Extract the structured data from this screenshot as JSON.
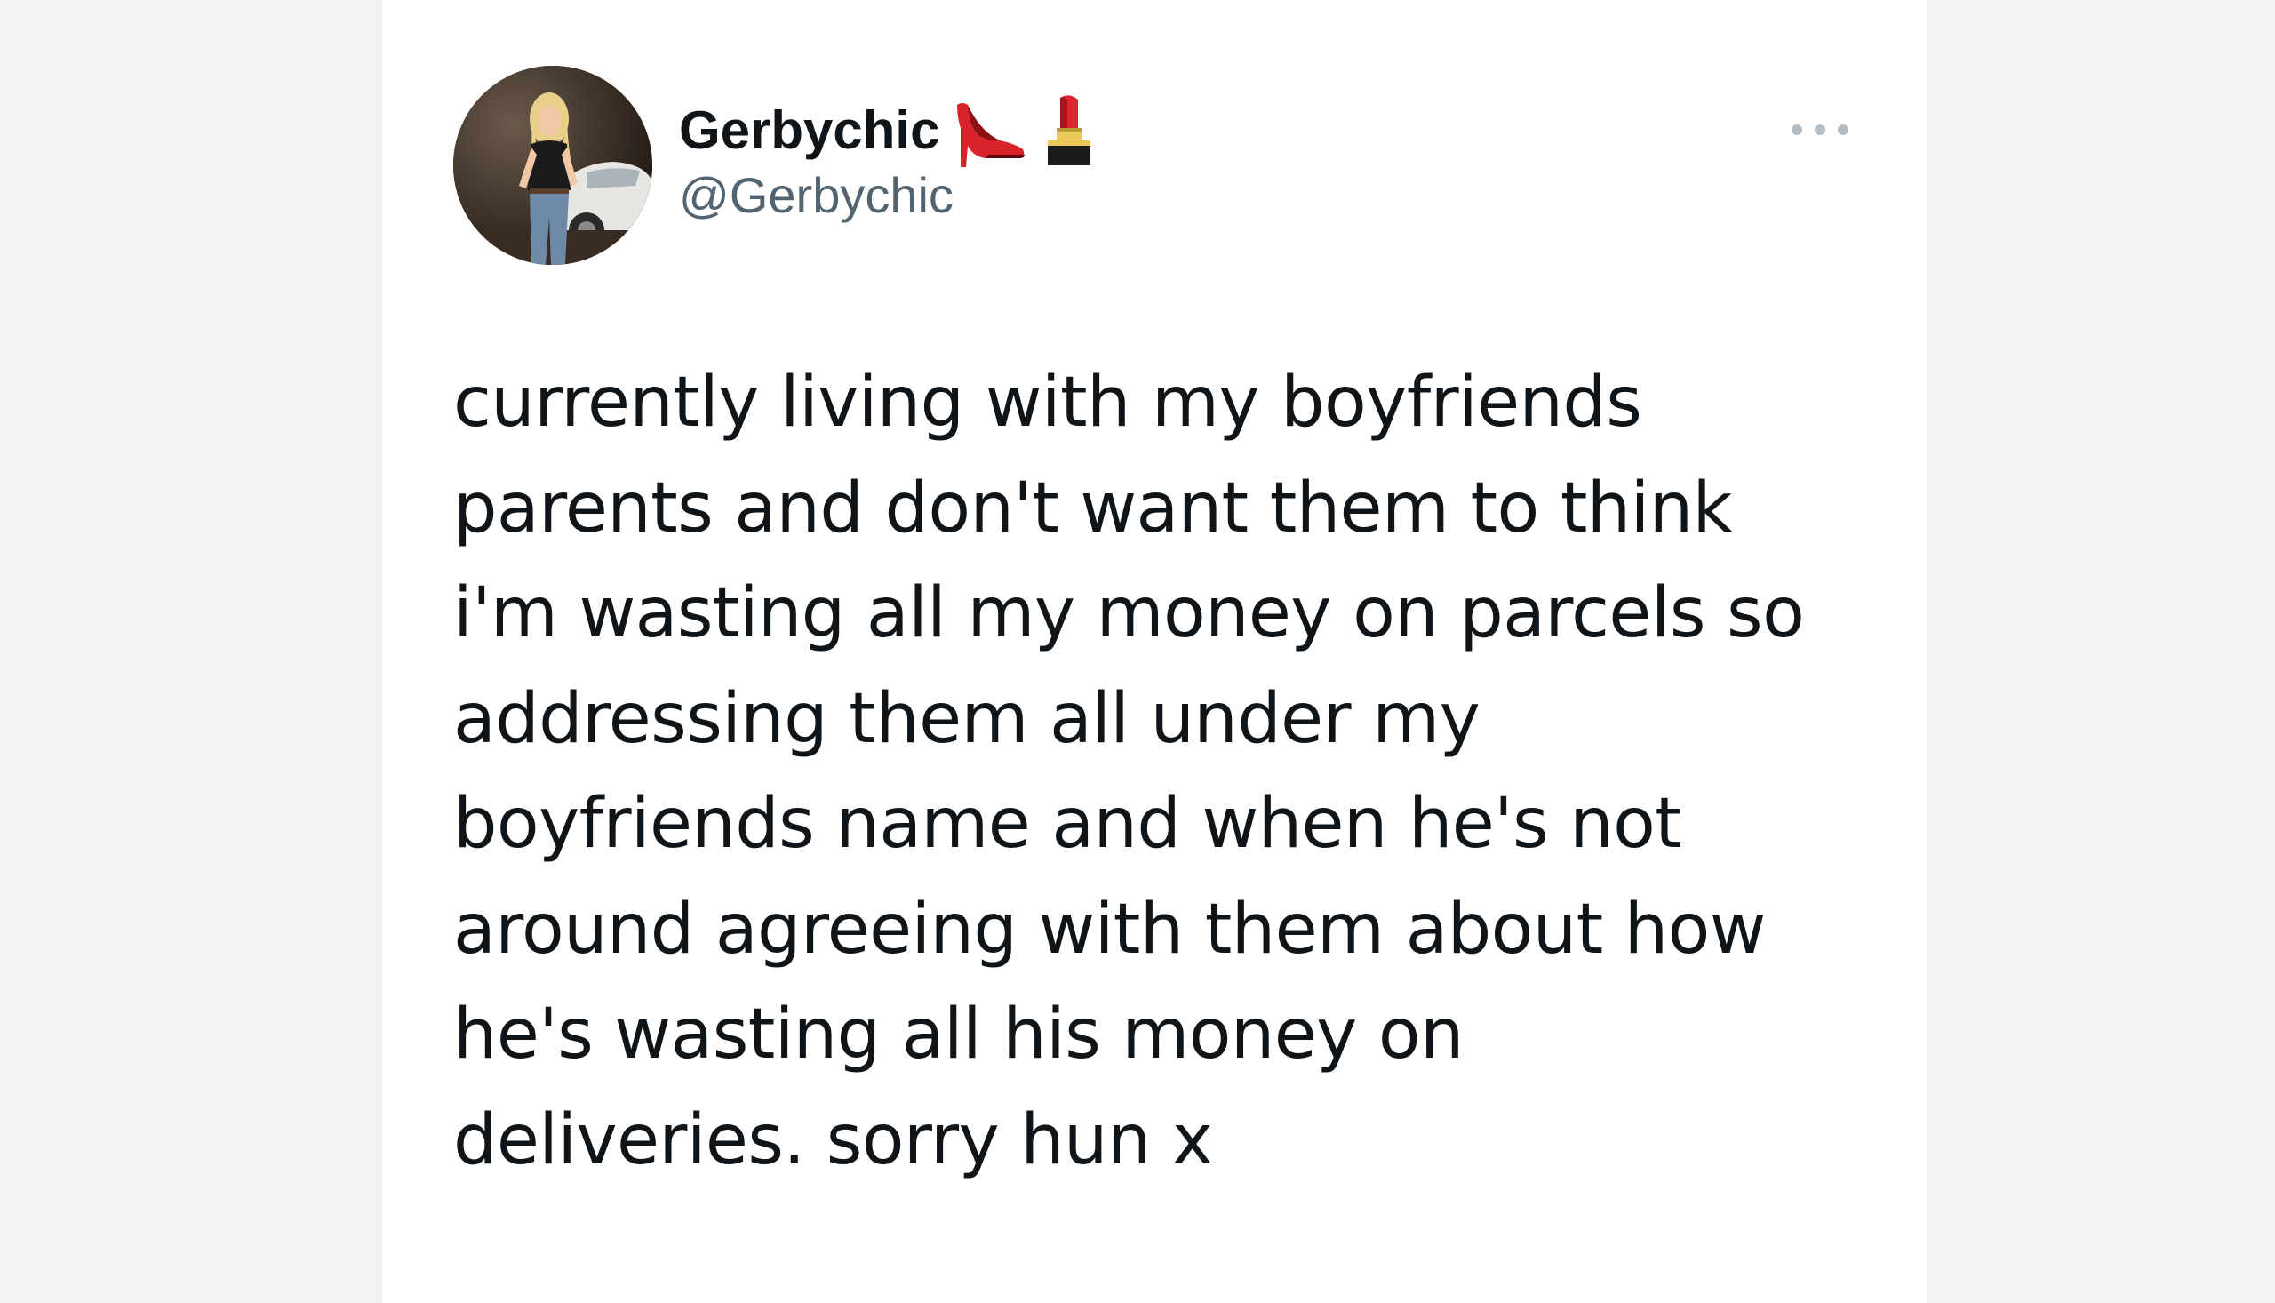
{
  "tweet": {
    "author": {
      "display_name": "Gerbychic",
      "handle": "@Gerbychic",
      "avatar": "profile-photo",
      "name_emojis": [
        "high-heel-shoe-icon",
        "lipstick-icon"
      ]
    },
    "menu_icon": "more-options-icon",
    "text": "currently living with my boyfriends\nparents and don't want them to think\ni'm wasting all my money on parcels so\naddressing them all under my\nboyfriends name and when he's not\naround agreeing with them about how\nhe's wasting all his money on\ndeliveries. sorry hun x"
  },
  "colors": {
    "page_background": "#f2f2f5",
    "card_background": "#ffffff",
    "text_primary": "#0f1419",
    "text_secondary": "#536471",
    "icon_muted": "#b4bcc4"
  }
}
